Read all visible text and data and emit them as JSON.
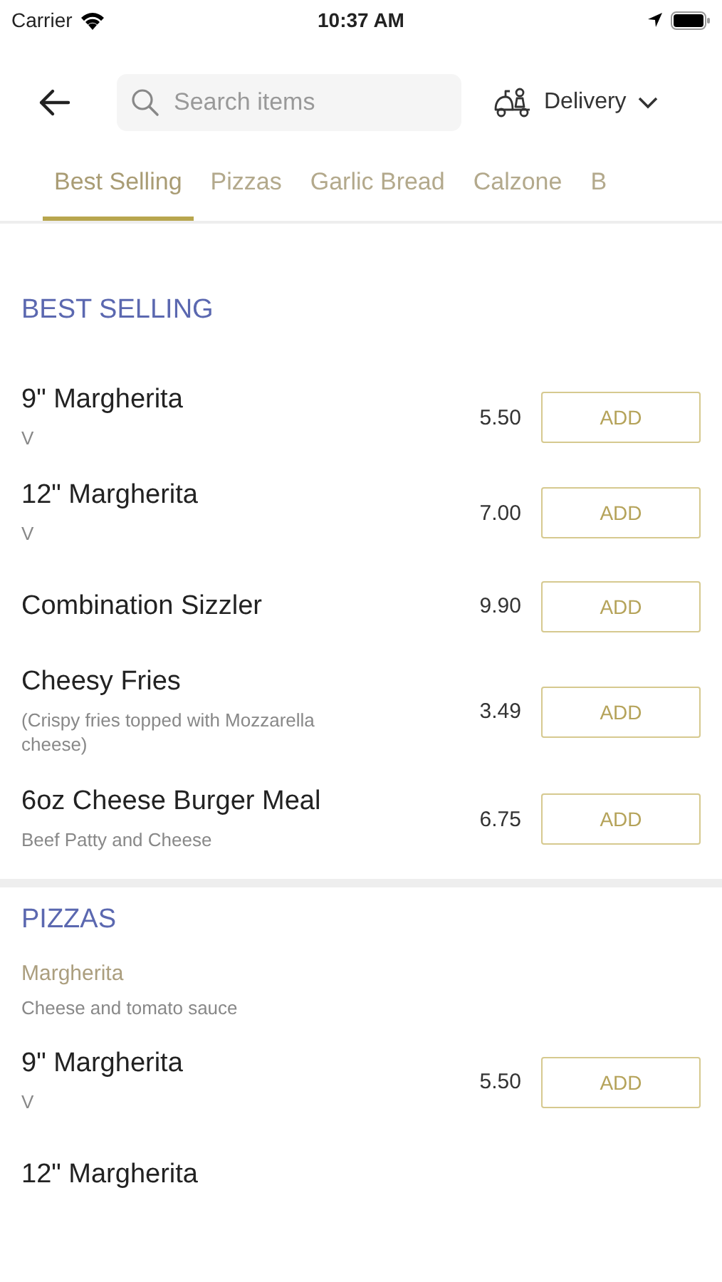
{
  "status_bar": {
    "carrier": "Carrier",
    "time": "10:37 AM"
  },
  "header": {
    "search": {
      "placeholder": "Search items"
    },
    "delivery": "Delivery"
  },
  "tabs": [
    {
      "label": "Best Selling",
      "selected": true
    },
    {
      "label": "Pizzas",
      "selected": false
    },
    {
      "label": "Garlic Bread",
      "selected": false
    },
    {
      "label": "Calzone",
      "selected": false
    },
    {
      "label": "B",
      "selected": false
    }
  ],
  "sections": [
    {
      "title": "BEST SELLING",
      "items": [
        {
          "name": "9\" Margherita",
          "description": "V",
          "price": "5.50",
          "button": "ADD"
        },
        {
          "name": "12\" Margherita",
          "description": "V",
          "price": "7.00",
          "button": "ADD"
        },
        {
          "name": "Combination Sizzler",
          "price": "9.90",
          "button": "ADD"
        },
        {
          "name": "Cheesy Fries",
          "description": "(Crispy fries topped with Mozzarella cheese)",
          "price": "3.49",
          "button": "ADD"
        },
        {
          "name": "6oz Cheese Burger Meal",
          "description": "Beef Patty and Cheese",
          "price": "6.75",
          "button": "ADD"
        }
      ]
    },
    {
      "title": "PIZZAS",
      "subheading": "Margherita",
      "subdescription": "Cheese and tomato sauce",
      "items": [
        {
          "name": "9\" Margherita",
          "description": "V",
          "price": "5.50",
          "button": "ADD"
        },
        {
          "name": "12\" Margherita"
        }
      ]
    }
  ]
}
